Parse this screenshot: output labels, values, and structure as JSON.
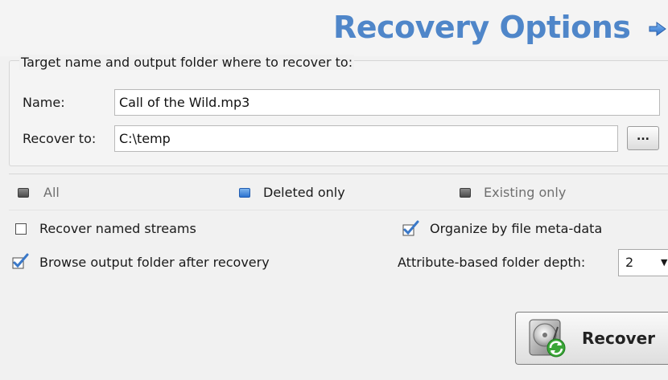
{
  "header": {
    "title": "Recovery Options",
    "next_icon": "right-arrow-icon"
  },
  "target_group": {
    "legend": "Target name and output folder where to recover to:",
    "name_label": "Name:",
    "name_value": "Call of the Wild.mp3",
    "recover_to_label": "Recover to:",
    "recover_to_value": "C:\\temp",
    "browse_label": "..."
  },
  "filter": {
    "options": [
      {
        "label": "All",
        "selected": false,
        "enabled": true
      },
      {
        "label": "Deleted only",
        "selected": true,
        "enabled": true
      },
      {
        "label": "Existing only",
        "selected": false,
        "enabled": false
      }
    ]
  },
  "options": {
    "recover_named_streams": {
      "label": "Recover named streams",
      "checked": false
    },
    "browse_after": {
      "label": "Browse output folder after recovery",
      "checked": true
    },
    "organize_meta": {
      "label": "Organize by file meta-data",
      "checked": true
    },
    "folder_depth_label": "Attribute-based folder depth:",
    "folder_depth_value": "2"
  },
  "actions": {
    "recover_label": "Recover",
    "recover_icon": "hard-disk-recover-icon"
  },
  "colors": {
    "title": "#4f86c9",
    "radio_selected": "#2c72cf",
    "checkmark": "#3a78c8",
    "recover_arrow": "#3aa637"
  }
}
